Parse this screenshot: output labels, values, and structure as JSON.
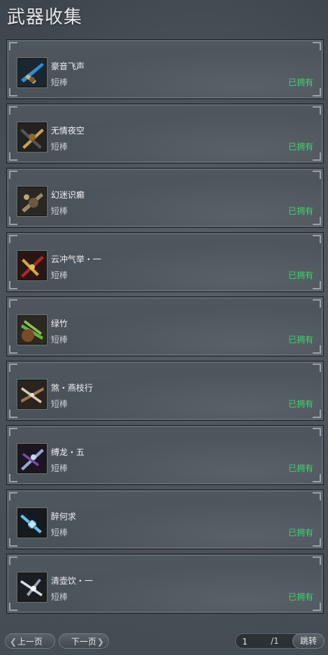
{
  "title": "武器收集",
  "items": [
    {
      "name": "豪音飞声",
      "type": "短棒",
      "status": "已拥有",
      "icon": "blue-blade-weapon-icon"
    },
    {
      "name": "无情夜空",
      "type": "短棒",
      "status": "已拥有",
      "icon": "gold-dark-weapon-icon"
    },
    {
      "name": "幻迷识癫",
      "type": "短棒",
      "status": "已拥有",
      "icon": "bronze-weapon-icon"
    },
    {
      "name": "云冲气举・一",
      "type": "短棒",
      "status": "已拥有",
      "icon": "red-gold-weapon-icon"
    },
    {
      "name": "绿竹",
      "type": "短棒",
      "status": "已拥有",
      "icon": "green-bamboo-weapon-icon"
    },
    {
      "name": "煞・燕枝行",
      "type": "短棒",
      "status": "已拥有",
      "icon": "wooden-crossed-weapon-icon"
    },
    {
      "name": "缚龙・五",
      "type": "短棒",
      "status": "已拥有",
      "icon": "purple-dragon-weapon-icon"
    },
    {
      "name": "醉何求",
      "type": "短棒",
      "status": "已拥有",
      "icon": "ice-blue-weapon-icon"
    },
    {
      "name": "清壶饮・一",
      "type": "短棒",
      "status": "已拥有",
      "icon": "silver-weapon-icon"
    }
  ],
  "pager": {
    "prev_label": "上一页",
    "next_label": "下一页",
    "current_page": "1",
    "total_pages": "/1",
    "jump_label": "跳转"
  },
  "colors": {
    "owned_status": "#3fd36a",
    "card_background": "#4d555c",
    "page_background": "#454c53"
  }
}
